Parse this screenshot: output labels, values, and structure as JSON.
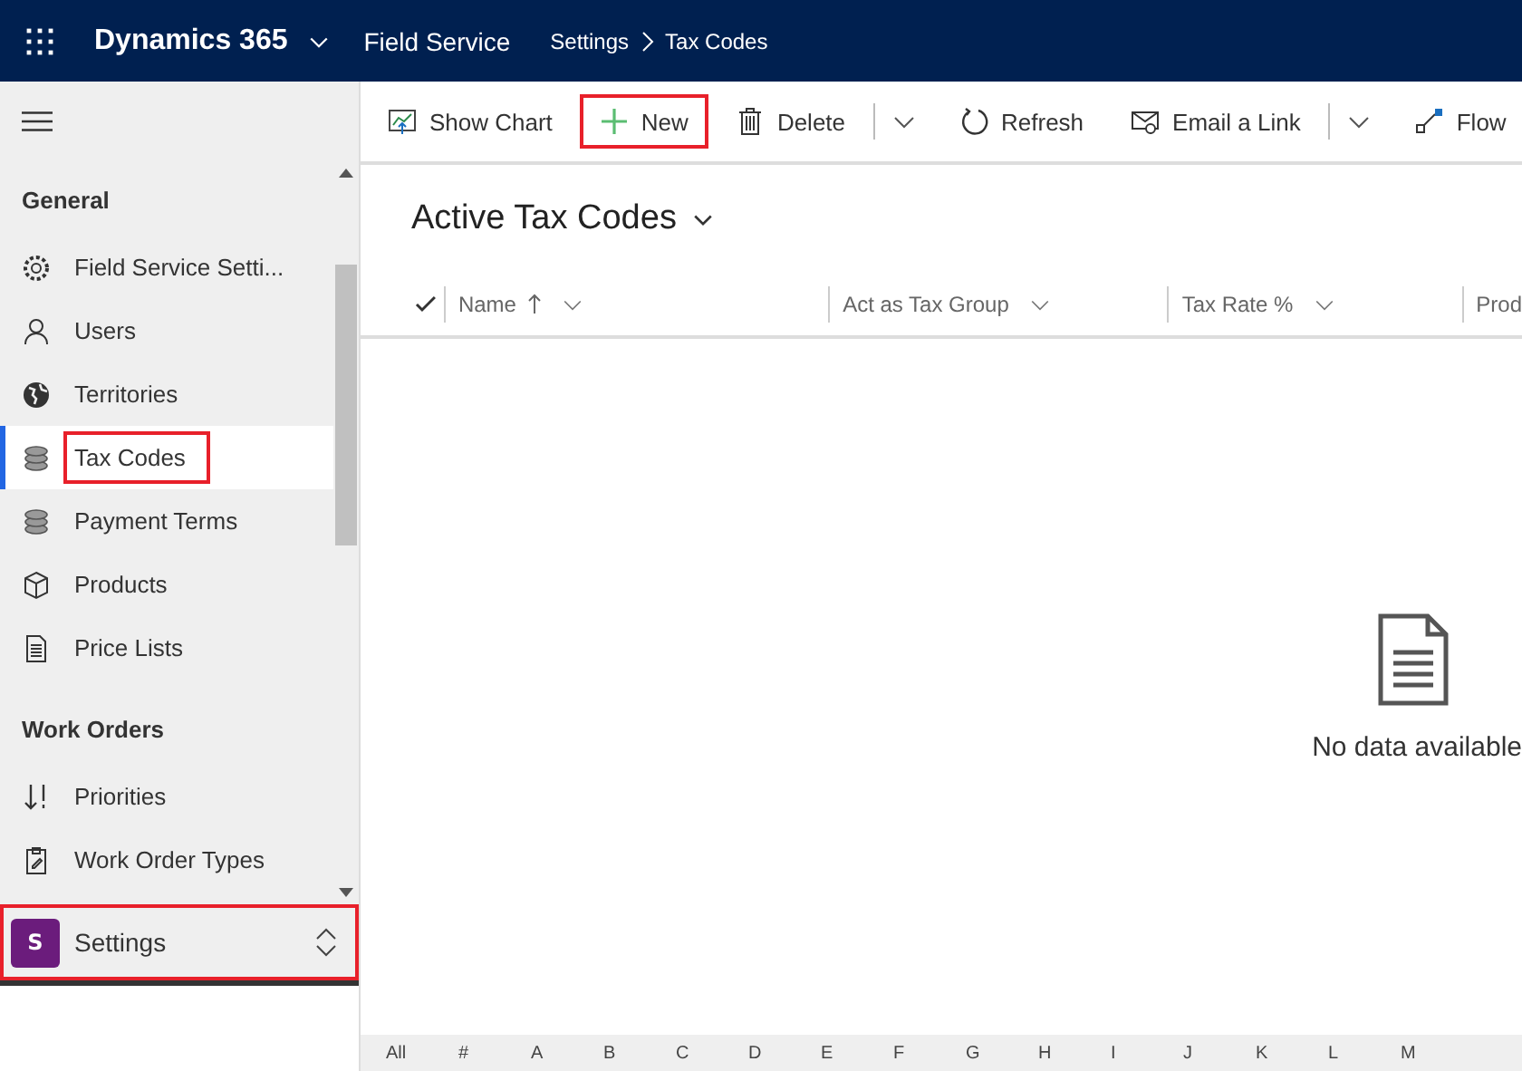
{
  "top_bar": {
    "app_name": "Dynamics 365",
    "area": "Field Service",
    "breadcrumb": [
      "Settings",
      "Tax Codes"
    ]
  },
  "sidebar": {
    "groups": [
      {
        "title": "General",
        "items": [
          {
            "label": "Field Service Setti...",
            "kind": "gear",
            "selected": false,
            "highlighted": false
          },
          {
            "label": "Users",
            "kind": "person",
            "selected": false,
            "highlighted": false
          },
          {
            "label": "Territories",
            "kind": "globe",
            "selected": false,
            "highlighted": false
          },
          {
            "label": "Tax Codes",
            "kind": "stack",
            "selected": true,
            "highlighted": true
          },
          {
            "label": "Payment Terms",
            "kind": "stack",
            "selected": false,
            "highlighted": false
          },
          {
            "label": "Products",
            "kind": "box",
            "selected": false,
            "highlighted": false
          },
          {
            "label": "Price Lists",
            "kind": "document",
            "selected": false,
            "highlighted": false
          }
        ]
      },
      {
        "title": "Work Orders",
        "items": [
          {
            "label": "Priorities",
            "kind": "priority",
            "selected": false,
            "highlighted": false
          },
          {
            "label": "Work Order Types",
            "kind": "clipboard",
            "selected": false,
            "highlighted": false
          }
        ]
      }
    ],
    "area_switcher": {
      "badge": "S",
      "label": "Settings",
      "highlighted": true
    }
  },
  "command_bar": [
    {
      "label": "Show Chart",
      "kind": "chart",
      "highlighted": false
    },
    {
      "label": "New",
      "kind": "plus",
      "highlighted": true
    },
    {
      "label": "Delete",
      "kind": "trash",
      "highlighted": false
    },
    {
      "kind": "caret"
    },
    {
      "label": "Refresh",
      "kind": "refresh",
      "highlighted": false
    },
    {
      "label": "Email a Link",
      "kind": "email",
      "highlighted": false
    },
    {
      "kind": "caret"
    },
    {
      "label": "Flow",
      "kind": "flow",
      "highlighted": false
    }
  ],
  "view": {
    "title": "Active Tax Codes",
    "columns": [
      {
        "label": "Name",
        "sorted": true
      },
      {
        "label": "Act as Tax Group",
        "sorted": false
      },
      {
        "label": "Tax Rate %",
        "sorted": false
      },
      {
        "label": "Prod",
        "sorted": false
      }
    ],
    "empty_message": "No data available",
    "jump_bar": [
      "All",
      "#",
      "A",
      "B",
      "C",
      "D",
      "E",
      "F",
      "G",
      "H",
      "I",
      "J",
      "K",
      "L",
      "M"
    ]
  }
}
